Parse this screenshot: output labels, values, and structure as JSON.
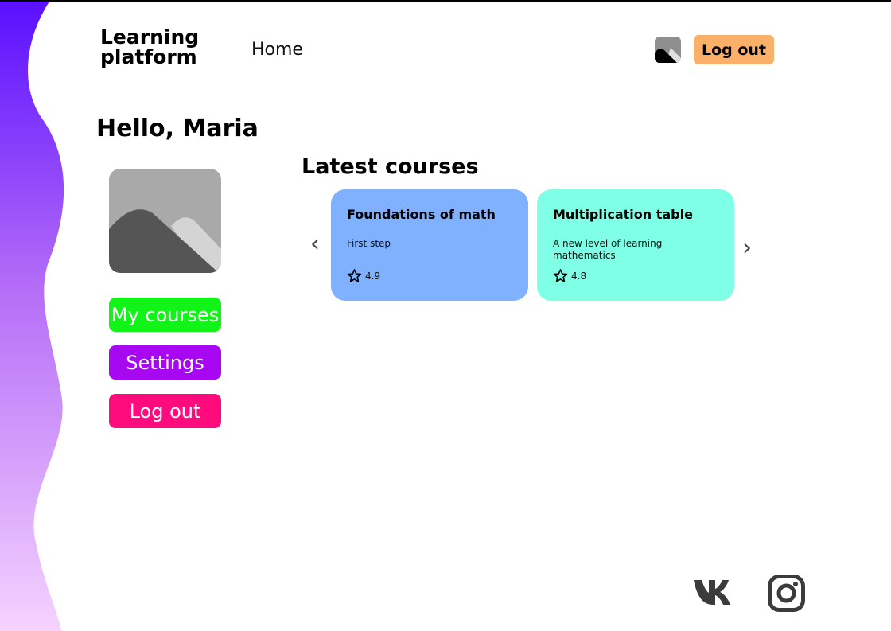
{
  "header": {
    "logo": "Learning platform",
    "nav_home": "Home",
    "logout_label": "Log out"
  },
  "greeting": "Hello, Maria",
  "sidebar": {
    "items": [
      {
        "label": "My courses",
        "color": "#11f418"
      },
      {
        "label": "Settings",
        "color": "#a807f2"
      },
      {
        "label": "Log out",
        "color": "#ff0b7e"
      }
    ]
  },
  "latest": {
    "title": "Latest courses",
    "prev_icon": "chevron-left-icon",
    "next_icon": "chevron-right-icon",
    "courses": [
      {
        "title": "Foundations of math",
        "description": "First step",
        "rating": "4.9",
        "color": "#80b1ff"
      },
      {
        "title": "Multiplication table",
        "description": "A new level of learning mathematics",
        "rating": "4.8",
        "color": "#7fffe6"
      }
    ]
  },
  "footer": {
    "social": [
      "vk-icon",
      "instagram-icon"
    ]
  },
  "colors": {
    "header_logout": "#fbb06a",
    "wave_top": "#5a10ff",
    "wave_bottom": "#f6d3ff"
  }
}
